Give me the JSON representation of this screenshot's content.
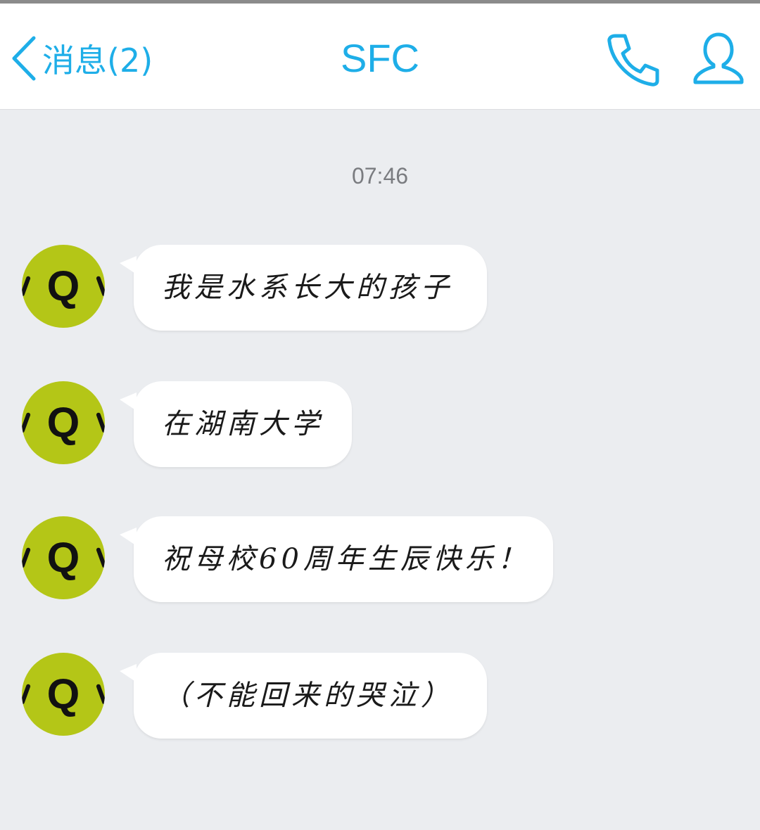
{
  "colors": {
    "accent": "#1eaee8",
    "background": "#ebedf0",
    "bubble": "#ffffff",
    "avatar": "#b4c617"
  },
  "header": {
    "back_label": "消息(2)",
    "title": "SFC",
    "back_icon": "chevron-left-icon",
    "call_icon": "phone-icon",
    "profile_icon": "user-icon"
  },
  "chat": {
    "timestamp": "07:46",
    "messages": [
      {
        "avatar_letter": "Q",
        "text": "我是水系长大的孩子"
      },
      {
        "avatar_letter": "Q",
        "text": "在湖南大学"
      },
      {
        "avatar_letter": "Q",
        "text": "祝母校60周年生辰快乐！"
      },
      {
        "avatar_letter": "Q",
        "text": "（不能回来的哭泣）"
      }
    ]
  }
}
